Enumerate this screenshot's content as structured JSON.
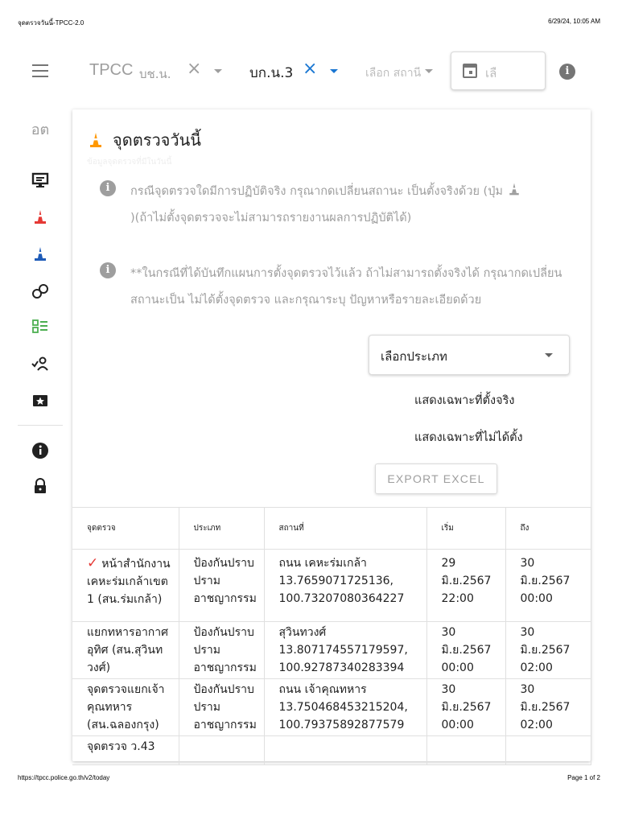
{
  "print": {
    "title": "จุดตรวจวันนี้-TPCC-2.0",
    "datetime": "6/29/24, 10:05 AM",
    "url": "https://tpcc.police.go.th/v2/today",
    "page": "Page 1 of 2"
  },
  "topbar": {
    "brand": "TPCC",
    "filter1": "บช.น.",
    "filter2": "บก.น.3",
    "station_placeholder": "เลือก สถานี",
    "date_placeholder": "เลื",
    "colors": {
      "accent": "#1976d2",
      "muted": "#9e9e9e"
    }
  },
  "rail": {
    "abbr": "อต",
    "icons": [
      "monitor-icon",
      "traffic-cone-red-icon",
      "traffic-cone-blue-icon",
      "handcuffs-icon",
      "checklist-icon",
      "users-check-icon",
      "star-ticket-icon",
      "info-icon",
      "lock-icon"
    ]
  },
  "card": {
    "title": "จุดตรวจวันนี้",
    "subtitle": "ข้อมูลจุดตรวจที่มีในวันนี้",
    "notice1": "กรณีจุดตรวจใดมีการปฏิบัติจริง กรุณากดเปลี่ยนสถานะ เป็นตั้งจริงด้วย (ปุ่ม",
    "notice1_tail": ")(ถ้าไม่ตั้งจุดตรวจจะไม่สามารถรายงานผลการปฏิบัติได้)",
    "notice2": "**ในกรณีที่ได้บันทึกแผนการตั้งจุดตรวจไว้แล้ว ถ้าไม่สามารถตั้งจริงได้ กรุณากดเปลี่ยนสถานะเป็น ไม่ได้ตั้งจุดตรวจ และกรุณาระบุ ปัญหาหรือรายละเอียดด้วย",
    "type_select": "เลือกประเภท",
    "filter_set": "แสดงเฉพาะที่ตั้งจริง",
    "filter_notset": "แสดงเฉพาะที่ไม่ได้ตั้ง",
    "export": "EXPORT EXCEL"
  },
  "table": {
    "headers": [
      "จุดตรวจ",
      "ประเภท",
      "สถานที่",
      "เริ่ม",
      "ถึง"
    ],
    "rows": [
      {
        "checkpoint": "หน้าสำนักงานเคหะร่มเกล้าเขต 1 (สน.ร่มเกล้า)",
        "type": "ป้องกันปราบปรามอาชญากรรม",
        "place": "ถนน เคหะร่มเกล้า",
        "lat": "13.7659071725136,",
        "lng": "100.73207080364227",
        "start_d": "29",
        "start_m": "มิ.ย.2567",
        "start_t": "22:00",
        "end_d": "30",
        "end_m": "มิ.ย.2567",
        "end_t": "00:00",
        "checked": true
      },
      {
        "checkpoint": "แยกทหารอากาศอุทิศ (สน.สุวินทวงศ์)",
        "type": "ป้องกันปราบปรามอาชญากรรม",
        "place": "สุวินทวงศ์",
        "lat": "13.807174557179597,",
        "lng": "100.92787340283394",
        "start_d": "30",
        "start_m": "มิ.ย.2567",
        "start_t": "00:00",
        "end_d": "30",
        "end_m": "มิ.ย.2567",
        "end_t": "02:00",
        "checked": false
      },
      {
        "checkpoint": "จุดตรวจแยกเจ้าคุณทหาร (สน.ฉลองกรุง)",
        "type": "ป้องกันปราบปรามอาชญากรรม",
        "place": "ถนน เจ้าคุณทหาร",
        "lat": "13.750468453215204,",
        "lng": "100.79375892877579",
        "start_d": "30",
        "start_m": "มิ.ย.2567",
        "start_t": "00:00",
        "end_d": "30",
        "end_m": "มิ.ย.2567",
        "end_t": "02:00",
        "checked": false
      },
      {
        "checkpoint": "จุดตรวจ ว.43",
        "type": "",
        "place": "",
        "lat": "",
        "lng": "",
        "start_d": "",
        "start_m": "",
        "start_t": "",
        "end_d": "",
        "end_m": "",
        "end_t": "",
        "checked": false
      }
    ]
  }
}
